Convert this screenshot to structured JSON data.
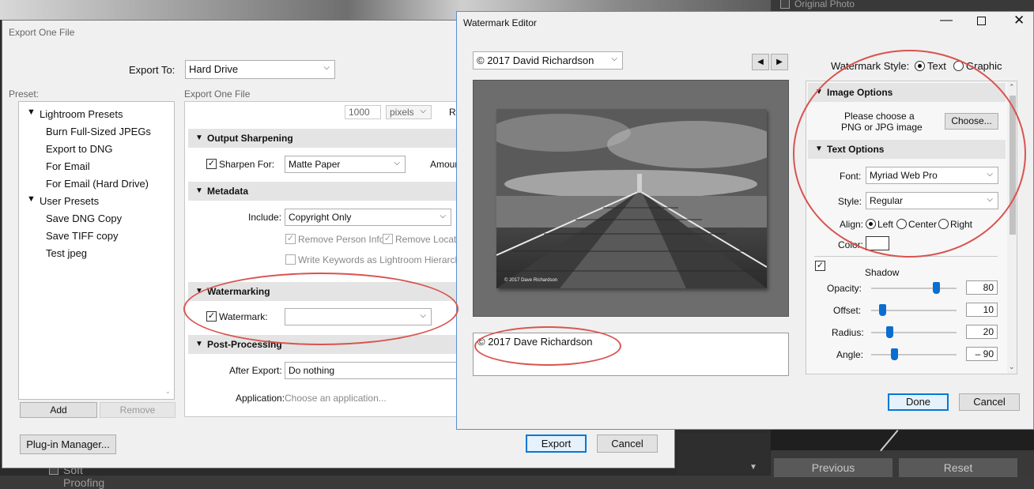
{
  "lightroom": {
    "original_photo": "Original Photo",
    "soft_proofing": "Soft Proofing",
    "previous": "Previous",
    "reset": "Reset"
  },
  "export_dialog": {
    "title": "Export One File",
    "export_to_label": "Export To:",
    "export_to_value": "Hard Drive",
    "preset_label": "Preset:",
    "presets_group": "Lightroom Presets",
    "presets": [
      "Burn Full-Sized JPEGs",
      "Export to DNG",
      "For Email",
      "For Email (Hard Drive)"
    ],
    "user_group": "User Presets",
    "user_presets": [
      "Save DNG Copy",
      "Save TIFF copy",
      "Test jpeg"
    ],
    "add": "Add",
    "remove": "Remove",
    "plugin_manager": "Plug-in Manager...",
    "export": "Export",
    "cancel": "Cancel",
    "panel_caption": "Export One File",
    "resolution_value": "1000",
    "resolution_unit": "pixels",
    "resolution_cut": "Re",
    "output_sharpening": {
      "header": "Output Sharpening",
      "sharpen_for_label": "Sharpen For:",
      "sharpen_for_value": "Matte Paper",
      "amount_cut": "Amoun"
    },
    "metadata": {
      "header": "Metadata",
      "include_label": "Include:",
      "include_value": "Copyright Only",
      "remove_person": "Remove Person Info",
      "remove_location": "Remove Location",
      "write_keywords": "Write Keywords as Lightroom Hierarchy"
    },
    "watermarking": {
      "header": "Watermarking",
      "watermark_label": "Watermark:"
    },
    "post_processing": {
      "header": "Post-Processing",
      "after_export_label": "After Export:",
      "after_export_value": "Do nothing",
      "application_label": "Application:",
      "application_placeholder": "Choose an application..."
    }
  },
  "watermark_editor": {
    "title": "Watermark Editor",
    "preset_value": "© 2017 David Richardson",
    "preview_caption": "© 2017 Dave Richardson",
    "text_value": "© 2017 Dave Richardson",
    "style_label": "Watermark Style:",
    "style_text": "Text",
    "style_graphic": "Graphic",
    "image_options": {
      "header": "Image Options",
      "prompt_line1": "Please choose a",
      "prompt_line2": "PNG or JPG image",
      "choose": "Choose..."
    },
    "text_options": {
      "header": "Text Options",
      "font_label": "Font:",
      "font_value": "Myriad Web Pro",
      "style_label": "Style:",
      "style_value": "Regular",
      "align_label": "Align:",
      "align_left": "Left",
      "align_center": "Center",
      "align_right": "Right",
      "color_label": "Color:"
    },
    "shadow": {
      "label": "Shadow",
      "opacity_label": "Opacity:",
      "opacity": "80",
      "offset_label": "Offset:",
      "offset": "10",
      "radius_label": "Radius:",
      "radius": "20",
      "angle_label": "Angle:",
      "angle": "– 90"
    },
    "done": "Done",
    "cancel": "Cancel"
  }
}
